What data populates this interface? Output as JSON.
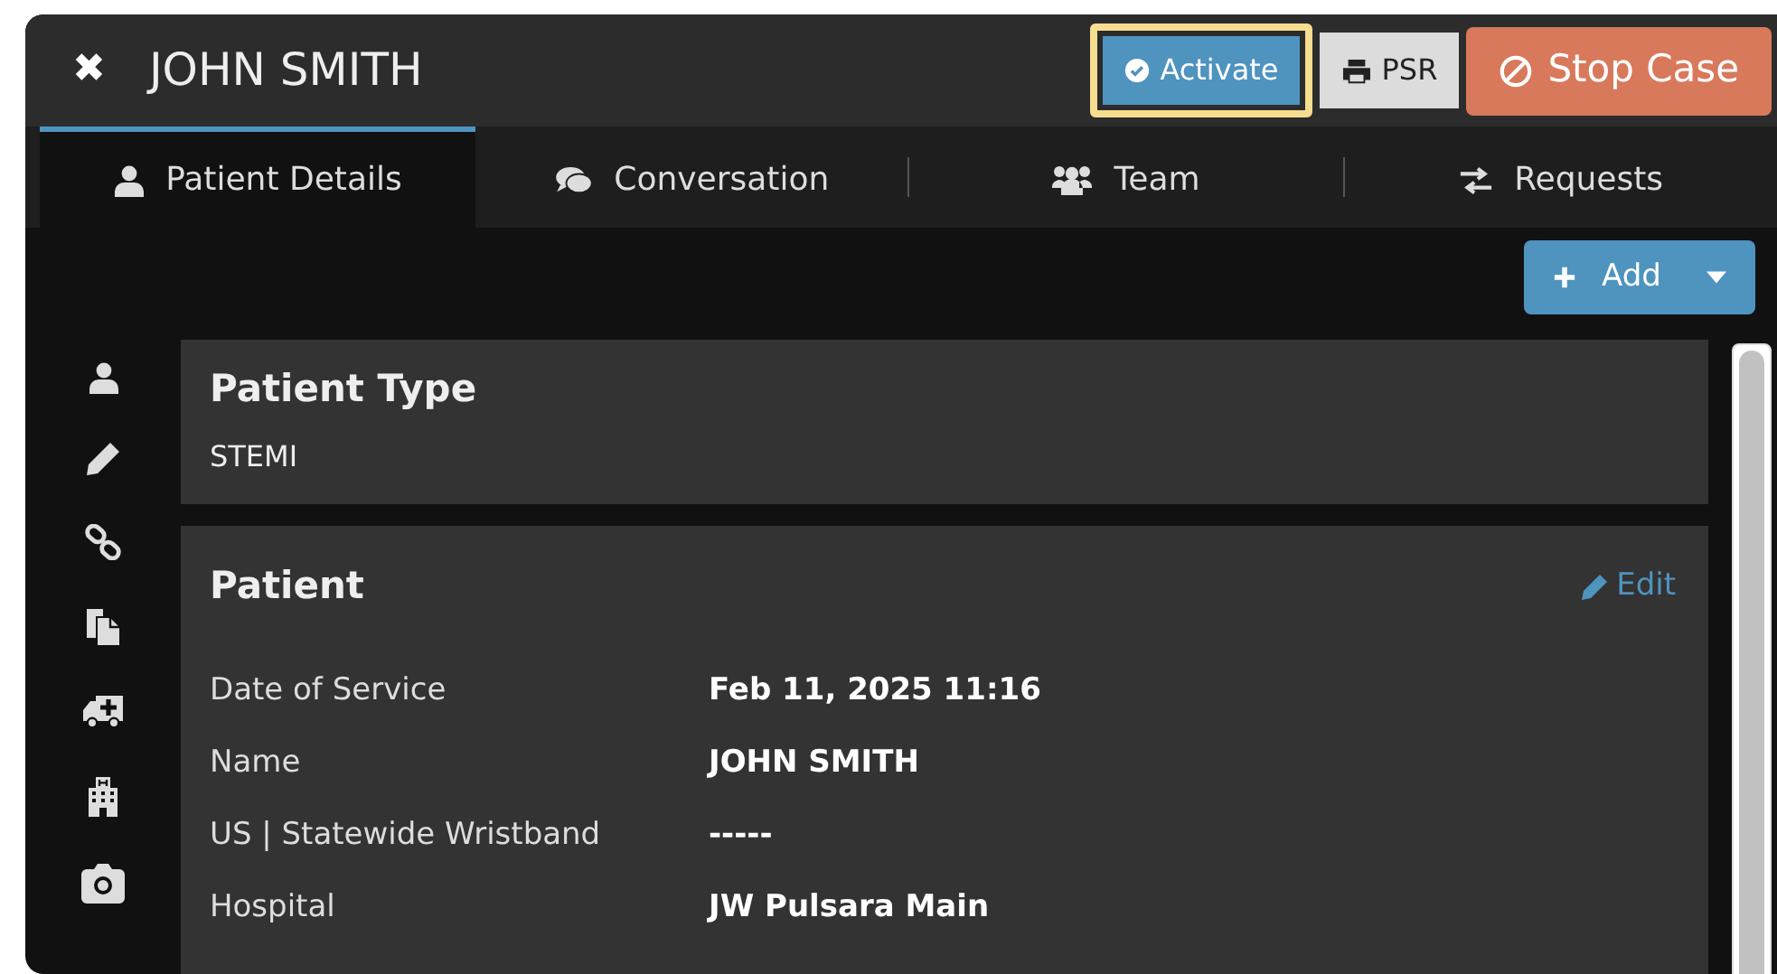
{
  "header": {
    "close": "✖",
    "title": "JOHN SMITH",
    "buttons": [
      {
        "kind": "activate",
        "label": "Activate",
        "highlighted": true
      },
      {
        "kind": "print",
        "label": "PSR",
        "highlighted": false
      },
      {
        "kind": "stop",
        "label": "Stop Case",
        "highlighted": false
      }
    ]
  },
  "tabs": [
    {
      "label": "Patient Details",
      "selected": true
    },
    {
      "label": "Conversation",
      "selected": false
    },
    {
      "label": "Team",
      "selected": false
    },
    {
      "label": "Requests",
      "selected": false
    }
  ],
  "add_button": {
    "label": "Add"
  },
  "patient_type": {
    "title": "Patient Type",
    "value": "STEMI"
  },
  "patient": {
    "title": "Patient",
    "edit": "Edit",
    "rows": [
      {
        "label": "Date of Service",
        "value": "Feb 11, 2025 11:16"
      },
      {
        "label": "Name",
        "value": "JOHN SMITH"
      },
      {
        "label": "US | Statewide Wristband",
        "value": "-----"
      },
      {
        "label": "Hospital",
        "value": "JW Pulsara Main"
      }
    ]
  }
}
